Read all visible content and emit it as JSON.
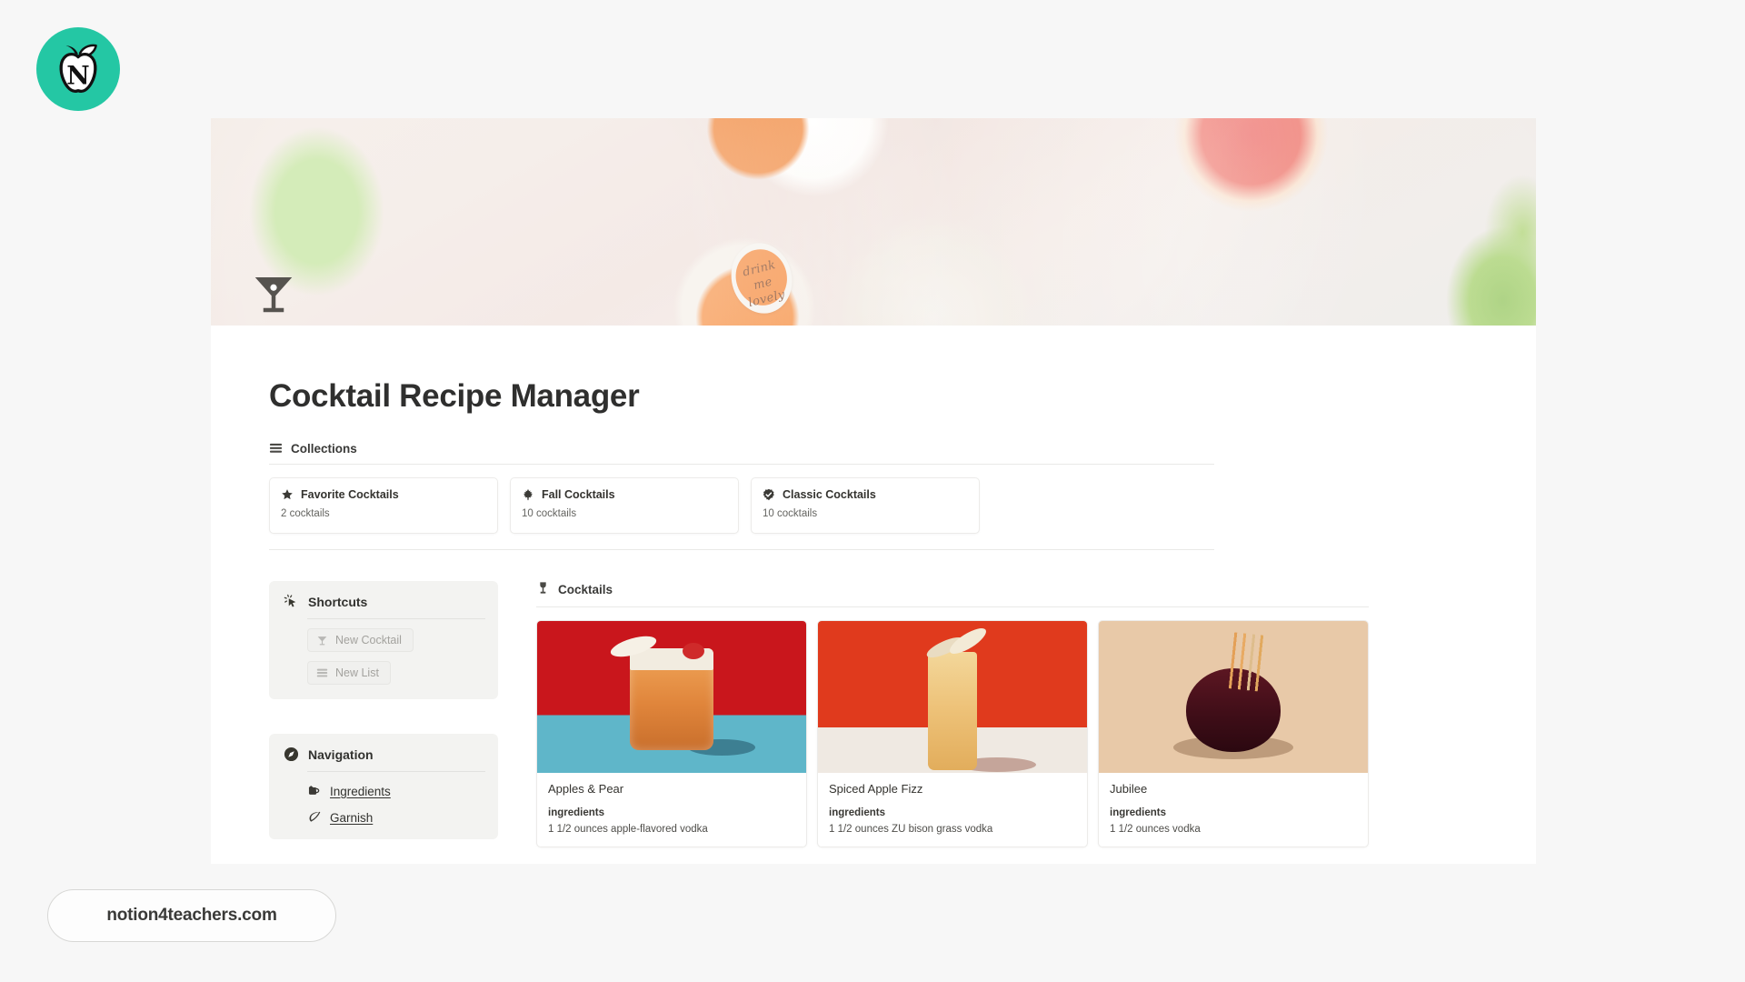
{
  "brand": {
    "logo_icon": "apple-n-logo-icon",
    "logo_letter": "N",
    "logo_color": "#24c7a4"
  },
  "cover": {
    "icon": "cover-photo",
    "tag_text": "drink me lovely"
  },
  "page": {
    "icon": "cocktail-glass-icon",
    "title": "Cocktail Recipe Manager"
  },
  "collections_section": {
    "icon": "list-icon",
    "label": "Collections",
    "items": [
      {
        "icon": "star-icon",
        "name": "Favorite Cocktails",
        "count": "2 cocktails"
      },
      {
        "icon": "maple-leaf-icon",
        "name": "Fall Cocktails",
        "count": "10 cocktails"
      },
      {
        "icon": "verified-badge-icon",
        "name": "Classic Cocktails",
        "count": "10 cocktails"
      }
    ]
  },
  "shortcuts_panel": {
    "icon": "cursor-click-icon",
    "title": "Shortcuts",
    "buttons": [
      {
        "icon": "martini-glass-icon",
        "label": "New Cocktail"
      },
      {
        "icon": "list-icon",
        "label": "New List"
      }
    ]
  },
  "navigation_panel": {
    "icon": "compass-icon",
    "title": "Navigation",
    "items": [
      {
        "icon": "pitcher-icon",
        "label": "Ingredients"
      },
      {
        "icon": "leaf-icon",
        "label": "Garnish"
      }
    ]
  },
  "cocktails_section": {
    "icon": "goblet-icon",
    "label": "Cocktails",
    "property_label": "ingredients",
    "cards": [
      {
        "title": "Apples & Pear",
        "ingredient": "1 1/2 ounces apple-flavored vodka"
      },
      {
        "title": "Spiced Apple Fizz",
        "ingredient": "1 1/2 ounces ZU bison grass vodka"
      },
      {
        "title": "Jubilee",
        "ingredient": "1 1/2 ounces vodka"
      }
    ]
  },
  "watermark": {
    "text": "notion4teachers.com"
  }
}
